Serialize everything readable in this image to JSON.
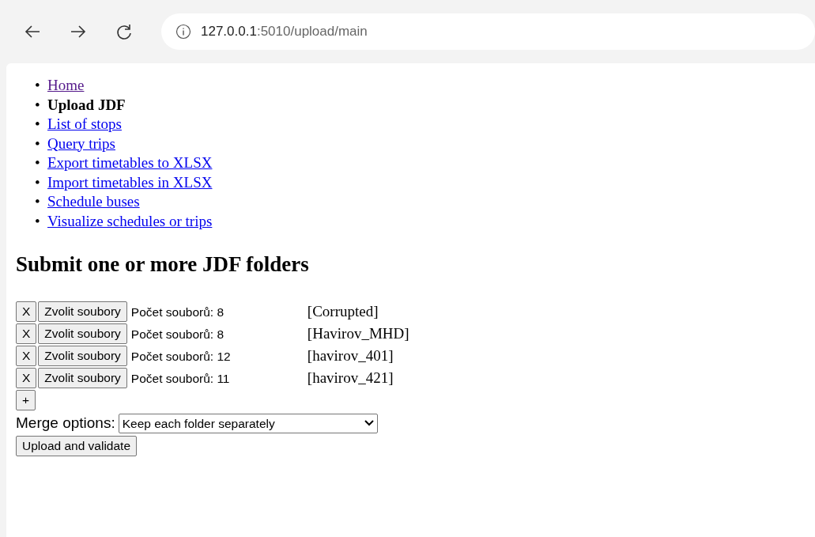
{
  "browser": {
    "url_host": "127.0.0.1",
    "url_path": ":5010/upload/main"
  },
  "nav": [
    {
      "bullet": "•",
      "label": "Home",
      "selected": false,
      "visited": true
    },
    {
      "bullet": "•",
      "label": "Upload JDF",
      "selected": true,
      "visited": false
    },
    {
      "bullet": "•",
      "label": "List of stops",
      "selected": false,
      "visited": false
    },
    {
      "bullet": "•",
      "label": "Query trips",
      "selected": false,
      "visited": false
    },
    {
      "bullet": "•",
      "label": "Export timetables to XLSX",
      "selected": false,
      "visited": false
    },
    {
      "bullet": "•",
      "label": "Import timetables in XLSX",
      "selected": false,
      "visited": false
    },
    {
      "bullet": "•",
      "label": "Schedule buses",
      "selected": false,
      "visited": false
    },
    {
      "bullet": "•",
      "label": "Visualize schedules or trips",
      "selected": false,
      "visited": false
    }
  ],
  "heading": "Submit one or more JDF folders",
  "folders": [
    {
      "remove": "X",
      "choose": "Zvolit soubory",
      "count": "Počet souborů: 8",
      "name": "[Corrupted]"
    },
    {
      "remove": "X",
      "choose": "Zvolit soubory",
      "count": "Počet souborů: 8",
      "name": "[Havirov_MHD]"
    },
    {
      "remove": "X",
      "choose": "Zvolit soubory",
      "count": "Počet souborů: 12",
      "name": "[havirov_401]"
    },
    {
      "remove": "X",
      "choose": "Zvolit soubory",
      "count": "Počet souborů: 11",
      "name": "[havirov_421]"
    }
  ],
  "add_button": "+",
  "merge": {
    "label": "Merge options:",
    "value": "Keep each folder separately"
  },
  "submit": "Upload and validate"
}
